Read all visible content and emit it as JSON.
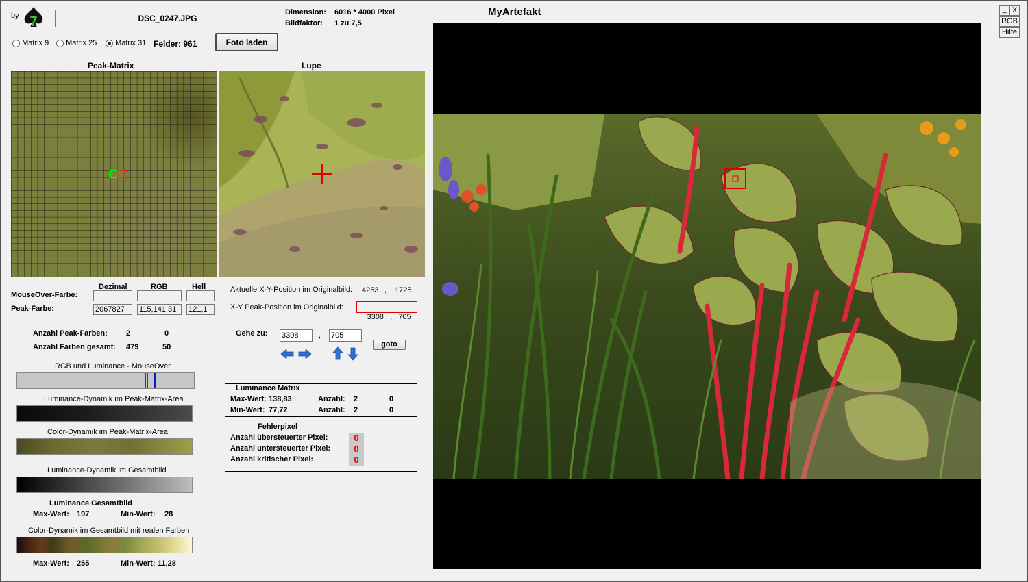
{
  "header": {
    "by": "by",
    "filename": "DSC_0247.JPG",
    "dimension_label": "Dimension:",
    "dimension_value": "6016 * 4000 Pixel",
    "factor_label": "Bildfaktor:",
    "factor_value": "1 zu 7,5",
    "app_title": "MyArtefakt"
  },
  "window_buttons": {
    "minimize": "_",
    "close": "X",
    "rgb": "RGB",
    "help": "Hilfe"
  },
  "matrix_options": [
    {
      "label": "Matrix 9",
      "selected": false
    },
    {
      "label": "Matrix 25",
      "selected": false
    },
    {
      "label": "Matrix 31",
      "selected": true
    }
  ],
  "felder": "Felder: 961",
  "load_button": "Foto laden",
  "peak_matrix": {
    "title": "Peak-Matrix",
    "base_color": "#7a7f3c",
    "marker_color": "#00ff00"
  },
  "lupe": {
    "title": "Lupe",
    "crosshair_color": "#e00000"
  },
  "color_table": {
    "headers": {
      "decimal": "Dezimal",
      "rgb": "RGB",
      "bright": "Hell"
    },
    "mouseover_label": "MouseOver-Farbe:",
    "mouseover": {
      "decimal": "",
      "rgb": "",
      "bright": ""
    },
    "peak_label": "Peak-Farbe:",
    "peak": {
      "decimal": "2067827",
      "rgb": "115,141,31",
      "bright": "121,1"
    }
  },
  "position": {
    "current_label": "Aktuelle X-Y-Position  im Originalbild:",
    "current_x": "4253",
    "current_y": "1725",
    "peak_label": "X-Y Peak-Position  im Originalbild:",
    "peak_value": "3308   ,   705",
    "separator": ","
  },
  "goto": {
    "label": "Gehe zu:",
    "x": "3308",
    "y": "705",
    "comma": ",",
    "button": "goto",
    "arrow_color": "#2f6fd0"
  },
  "counts": {
    "peak_colors_label": "Anzahl Peak-Farben:",
    "peak_colors_a": "2",
    "peak_colors_b": "0",
    "total_colors_label": "Anzahl Farben gesamt:",
    "total_colors_a": "479",
    "total_colors_b": "50"
  },
  "bars": {
    "rgb_lum_mouseover": "RGB und Luminance - MouseOver",
    "lum_peak_area": "Luminance-Dynamik im Peak-Matrix-Area",
    "color_peak_area": "Color-Dynamik im Peak-Matrix-Area",
    "lum_total": "Luminance-Dynamik im Gesamtbild",
    "lum_total_title": "Luminance Gesamtbild",
    "lum_max_label": "Max-Wert:",
    "lum_max": "197",
    "lum_min_label": "Min-Wert:",
    "lum_min": "28",
    "color_total": "Color-Dynamik im Gesamtbild mit realen Farben",
    "color_max_label": "Max-Wert:",
    "color_max": "255",
    "color_min_label": "Min-Wert:",
    "color_min": "11,28"
  },
  "luminance_matrix": {
    "title": "Luminance Matrix",
    "max_label": "Max-Wert:",
    "max_value": "138,83",
    "min_label": "Min-Wert:",
    "min_value": "77,72",
    "count_label": "Anzahl:",
    "max_count_a": "2",
    "max_count_b": "0",
    "min_count_a": "2",
    "min_count_b": "0"
  },
  "error_pixels": {
    "title": "Fehlerpixel",
    "over_label": "Anzahl übersteuerter Pixel:",
    "over": "0",
    "under_label": "Anzahl untersteuerter Pixel:",
    "under": "0",
    "critical_label": "Anzahl kritischer Pixel:",
    "critical": "0"
  }
}
